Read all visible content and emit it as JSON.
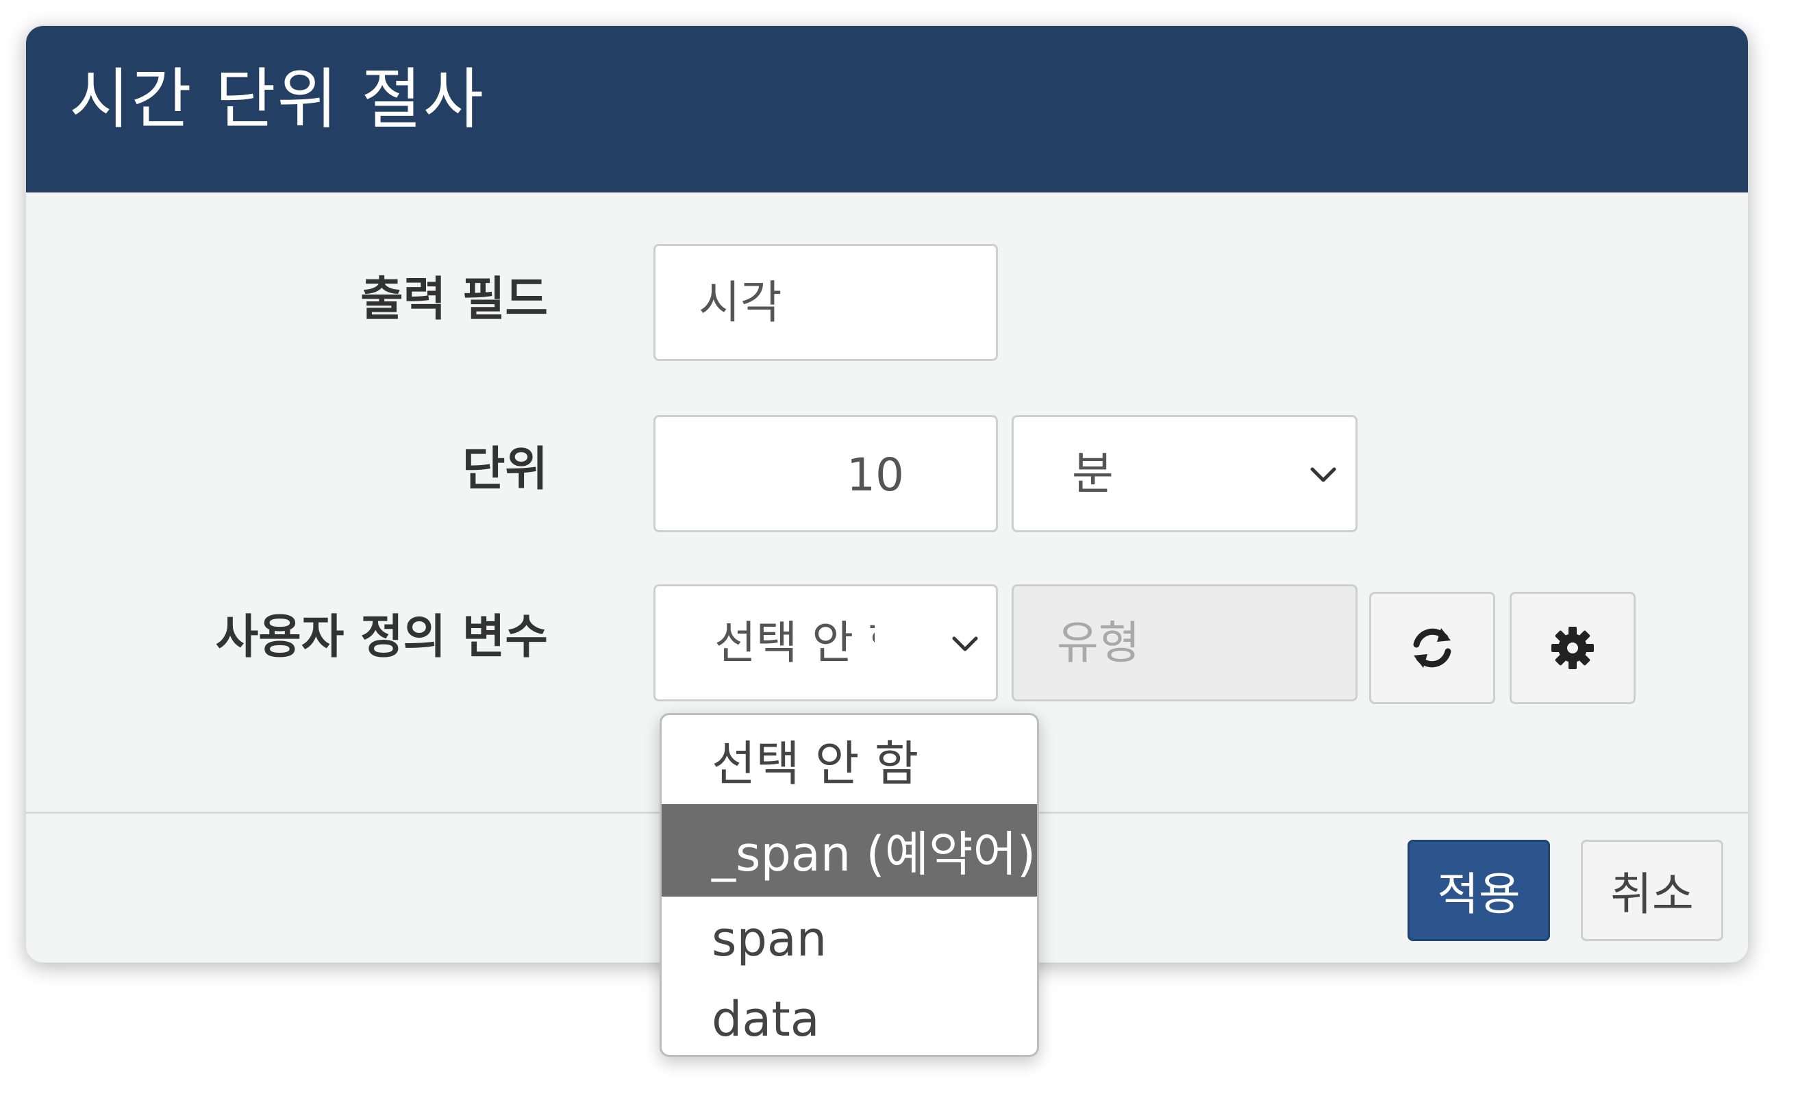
{
  "dialog": {
    "title": "시간 단위 절사"
  },
  "form": {
    "output_field": {
      "label": "출력 필드",
      "value": "시각"
    },
    "unit": {
      "label": "단위",
      "value": "10",
      "unit_selected": "분"
    },
    "custom_variable": {
      "label": "사용자 정의 변수",
      "selected": "선택 안 함",
      "type_placeholder": "유형",
      "refresh_icon": "refresh-icon",
      "settings_icon": "gear-icon",
      "options": [
        {
          "label": "선택 안 함",
          "highlighted": false
        },
        {
          "label": "_span (예약어)",
          "highlighted": true
        },
        {
          "label": "span",
          "highlighted": false
        },
        {
          "label": "data",
          "highlighted": false
        }
      ]
    }
  },
  "footer": {
    "apply_label": "적용",
    "cancel_label": "취소"
  },
  "colors": {
    "header_bg": "#233f64",
    "primary_button": "#2b558c",
    "highlight_option": "#6d6d6d",
    "dialog_bg": "#f3f4f4"
  }
}
